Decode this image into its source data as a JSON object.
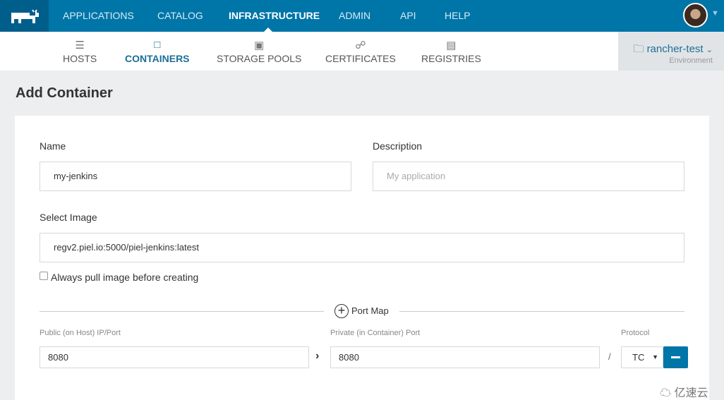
{
  "nav": {
    "items": [
      "APPLICATIONS",
      "CATALOG",
      "INFRASTRUCTURE",
      "ADMIN",
      "API",
      "HELP"
    ],
    "active": "INFRASTRUCTURE"
  },
  "subnav": {
    "items": [
      {
        "label": "HOSTS",
        "icon": "server-icon"
      },
      {
        "label": "CONTAINERS",
        "icon": "cube-icon"
      },
      {
        "label": "STORAGE POOLS",
        "icon": "hard-drive-icon"
      },
      {
        "label": "CERTIFICATES",
        "icon": "certificate-icon"
      },
      {
        "label": "REGISTRIES",
        "icon": "database-icon"
      }
    ],
    "active": "CONTAINERS"
  },
  "environment": {
    "name": "rancher-test",
    "label": "Environment"
  },
  "page": {
    "title": "Add Container"
  },
  "form": {
    "name_label": "Name",
    "name_value": "my-jenkins",
    "description_label": "Description",
    "description_placeholder": "My application",
    "image_label": "Select Image",
    "image_value": "regv2.piel.io:5000/piel-jenkins:latest",
    "always_pull_label": "Always pull image before creating",
    "always_pull_checked": false,
    "port_map_label": "Port Map",
    "public_label": "Public (on Host) IP/Port",
    "public_value": "8080",
    "private_label": "Private (in Container) Port",
    "private_value": "8080",
    "separator": "/",
    "protocol_label": "Protocol",
    "protocol_value": "TC"
  },
  "watermark": "亿速云",
  "colors": {
    "header": "#0075a8",
    "accent": "#1c6e98"
  }
}
